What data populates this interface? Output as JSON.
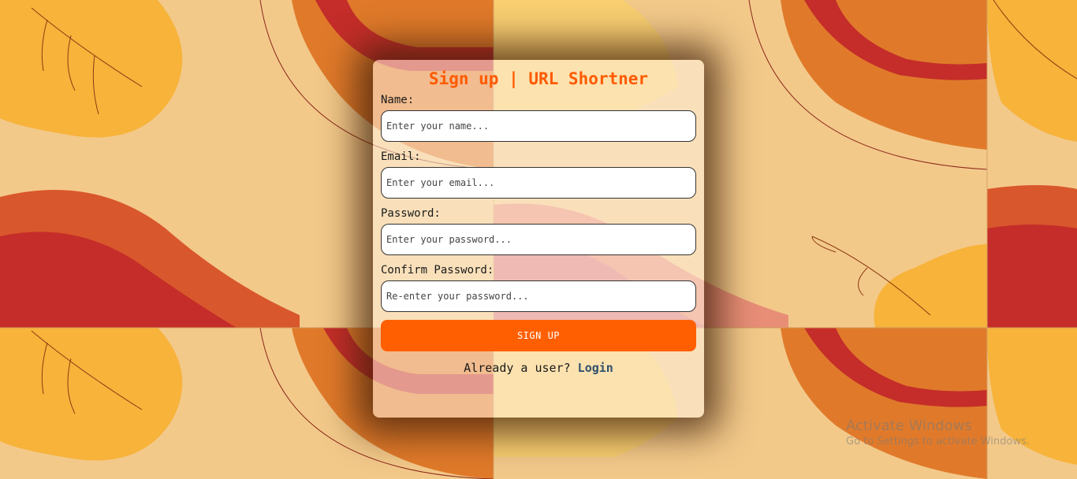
{
  "form": {
    "title": "Sign up | URL Shortner",
    "fields": [
      {
        "label": "Name:",
        "placeholder": "Enter your name..."
      },
      {
        "label": "Email:",
        "placeholder": "Enter your email..."
      },
      {
        "label": "Password:",
        "placeholder": "Enter your password..."
      },
      {
        "label": "Confirm Password:",
        "placeholder": "Re-enter your password..."
      }
    ],
    "submit_label": "SIGN UP",
    "footer_text": "Already a user?",
    "login_link": "Login"
  },
  "watermark": {
    "line1": "Activate Windows",
    "line2": "Go to Settings to activate Windows."
  },
  "colors": {
    "accent": "#ff5f00",
    "title": "#ff5a00",
    "link": "#31506e",
    "background": "#f3c98a"
  }
}
